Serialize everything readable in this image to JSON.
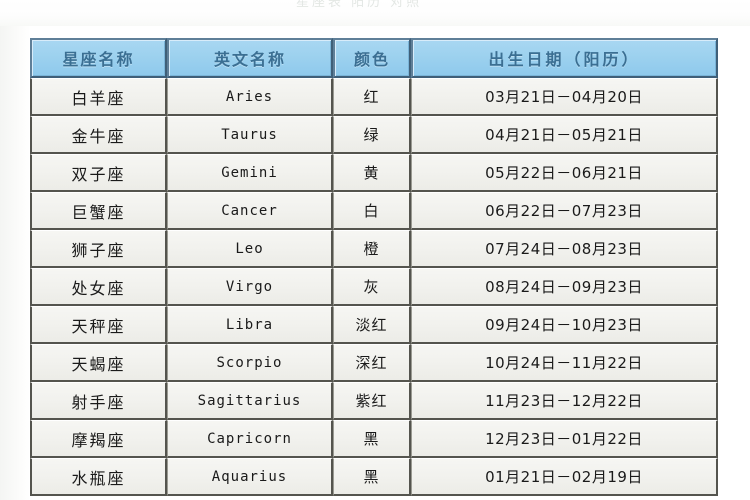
{
  "page": {
    "top_faint_text": "星座表 阳历 对照",
    "background_color": "#ffffff"
  },
  "table": {
    "name": "zodiac-sign-table",
    "header_bg_color": "#9ed2ef",
    "header_text_color": "#3b6f93",
    "cell_bg_color": "#f1f1ed",
    "border_color": "#54544e",
    "columns": [
      {
        "key": "name_cn",
        "label": "星座名称"
      },
      {
        "key": "name_en",
        "label": "英文名称"
      },
      {
        "key": "color",
        "label": "颜色"
      },
      {
        "key": "date",
        "label": "出生日期（阳历）"
      }
    ],
    "rows": [
      {
        "name_cn": "白羊座",
        "name_en": "Aries",
        "color": "红",
        "date": "03月21日－04月20日"
      },
      {
        "name_cn": "金牛座",
        "name_en": "Taurus",
        "color": "绿",
        "date": "04月21日－05月21日"
      },
      {
        "name_cn": "双子座",
        "name_en": "Gemini",
        "color": "黄",
        "date": "05月22日－06月21日"
      },
      {
        "name_cn": "巨蟹座",
        "name_en": "Cancer",
        "color": "白",
        "date": "06月22日－07月23日"
      },
      {
        "name_cn": "狮子座",
        "name_en": "Leo",
        "color": "橙",
        "date": "07月24日－08月23日"
      },
      {
        "name_cn": "处女座",
        "name_en": "Virgo",
        "color": "灰",
        "date": "08月24日－09月23日"
      },
      {
        "name_cn": "天秤座",
        "name_en": "Libra",
        "color": "淡红",
        "date": "09月24日－10月23日"
      },
      {
        "name_cn": "天蝎座",
        "name_en": "Scorpio",
        "color": "深红",
        "date": "10月24日－11月22日"
      },
      {
        "name_cn": "射手座",
        "name_en": "Sagittarius",
        "color": "紫红",
        "date": "11月23日－12月22日"
      },
      {
        "name_cn": "摩羯座",
        "name_en": "Capricorn",
        "color": "黑",
        "date": "12月23日－01月22日"
      },
      {
        "name_cn": "水瓶座",
        "name_en": "Aquarius",
        "color": "黑",
        "date": "01月21日－02月19日"
      }
    ]
  }
}
